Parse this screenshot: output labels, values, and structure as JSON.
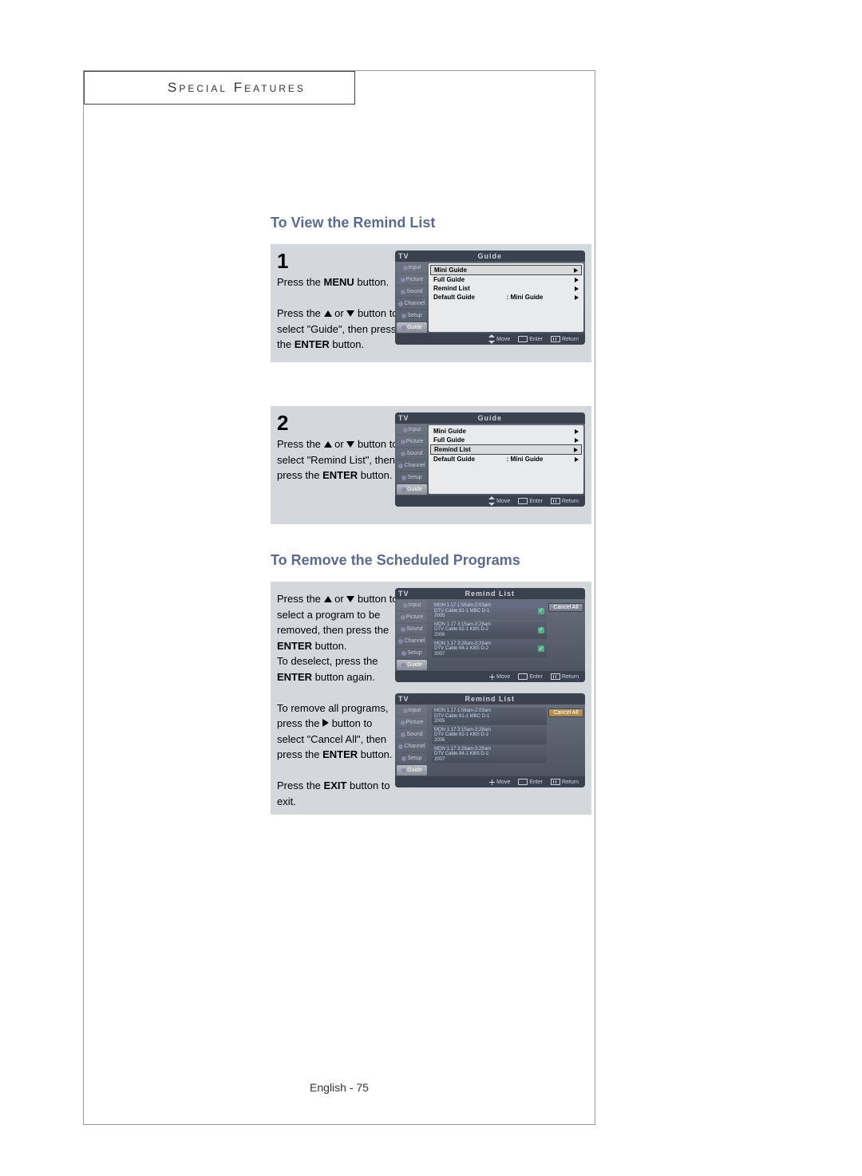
{
  "sectionHeader": "Special Features",
  "heading1": "To View the Remind List",
  "heading2": "To Remove the Scheduled Programs",
  "pageNum": "English - 75",
  "step1": {
    "num": "1",
    "line1a": "Press the ",
    "line1b": "MENU",
    "line1c": " button.",
    "line2a": "Press the ",
    "line2b": " or ",
    "line2c": " button to select \"Guide\", then press the ",
    "line2d": "ENTER",
    "line2e": " button."
  },
  "step2": {
    "num": "2",
    "line1a": "Press the ",
    "line1b": " or ",
    "line1c": " button to select \"Remind List\", then press the ",
    "line1d": "ENTER",
    "line1e": " button."
  },
  "step3": {
    "p1a": "Press the ",
    "p1b": " or ",
    "p1c": " button to select a program to be removed, then press the ",
    "p1d": "ENTER",
    "p1e": " button.",
    "p1f": "To deselect, press the ",
    "p1g": "ENTER",
    "p1h": " button again.",
    "p2a": "To remove all programs, press the ",
    "p2b": " button to select \"Cancel All\", then press the ",
    "p2c": "ENTER",
    "p2d": " button.",
    "p3a": "Press the ",
    "p3b": "EXIT",
    "p3c": " button to exit."
  },
  "tv": {
    "titleLeft": "TV",
    "titleGuide": "Guide",
    "titleRemind": "Remind List",
    "sidebar": [
      "Input",
      "Picture",
      "Sound",
      "Channel",
      "Setup",
      "Guide"
    ],
    "guideRows": [
      {
        "label": "Mini Guide",
        "value": ""
      },
      {
        "label": "Full Guide",
        "value": ""
      },
      {
        "label": "Remind List",
        "value": ""
      },
      {
        "label": "Default Guide",
        "value": ":   Mini Guide"
      }
    ],
    "footer": {
      "move": "Move",
      "enter": "Enter",
      "return": "Return"
    },
    "remindRows": [
      {
        "l1": "MON 1.17 1:56am-2:03am",
        "l2": "DTV Cable 81-1 MBC D-1",
        "l3": "2005"
      },
      {
        "l1": "MON 1.17 3:15am-3:28am",
        "l2": "DTV Cable 82-1 KBS D-2",
        "l3": "2006"
      },
      {
        "l1": "MON 1.17 3:28am-3:29am",
        "l2": "DTV Cable 84-1 KBS D-2",
        "l3": "2007"
      }
    ],
    "cancelAll": "Cancel All"
  }
}
